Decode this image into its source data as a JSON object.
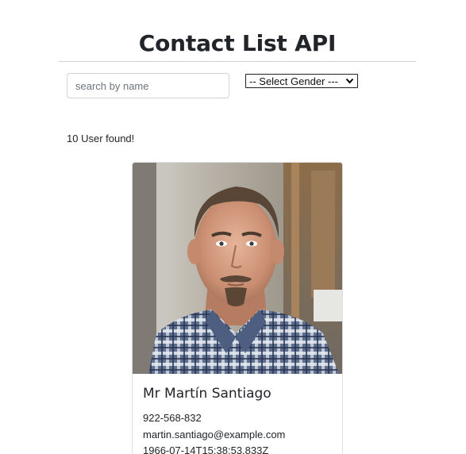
{
  "header": {
    "title": "Contact List API"
  },
  "filters": {
    "search_placeholder": "search by name",
    "gender_select": {
      "selected": "-- Select Gender ---"
    }
  },
  "results": {
    "count_text": "10 User found!"
  },
  "card": {
    "name": "Mr Martín Santiago",
    "phone": "922-568-832",
    "email": "martin.santiago@example.com",
    "dob": "1966-07-14T15:38:53.833Z"
  },
  "colors": {
    "border": "#ced4da",
    "rule": "#cfd2d5",
    "text": "#212529"
  },
  "icons": {
    "select_arrow": "chevron-down-icon"
  }
}
